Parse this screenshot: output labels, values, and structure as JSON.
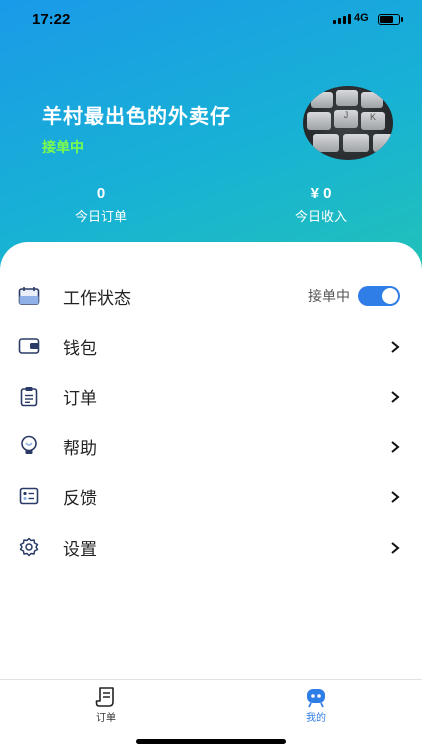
{
  "status_bar": {
    "time": "17:22",
    "network": "4G"
  },
  "profile": {
    "name": "羊村最出色的外卖仔",
    "status_tag": "接单中",
    "avatar_keys": [
      "J",
      "K"
    ]
  },
  "stats": [
    {
      "value": "0",
      "label": "今日订单"
    },
    {
      "value": "¥ 0",
      "label": "今日收入"
    }
  ],
  "menu": [
    {
      "label": "工作状态",
      "icon": "calendar-icon",
      "trailing_text": "接单中",
      "toggle_on": true
    },
    {
      "label": "钱包",
      "icon": "wallet-icon"
    },
    {
      "label": "订单",
      "icon": "clipboard-icon"
    },
    {
      "label": "帮助",
      "icon": "lightbulb-icon"
    },
    {
      "label": "反馈",
      "icon": "feedback-icon"
    },
    {
      "label": "设置",
      "icon": "gear-icon"
    }
  ],
  "tabbar": [
    {
      "label": "订单",
      "icon": "order-scroll-icon",
      "active": false
    },
    {
      "label": "我的",
      "icon": "robot-face-icon",
      "active": true
    }
  ],
  "colors": {
    "accent": "#2f7de6",
    "status_green": "#7dff4a",
    "tab_active": "#2f7de6",
    "tab_inactive": "#333333",
    "icon_navy": "#2a3a66"
  }
}
